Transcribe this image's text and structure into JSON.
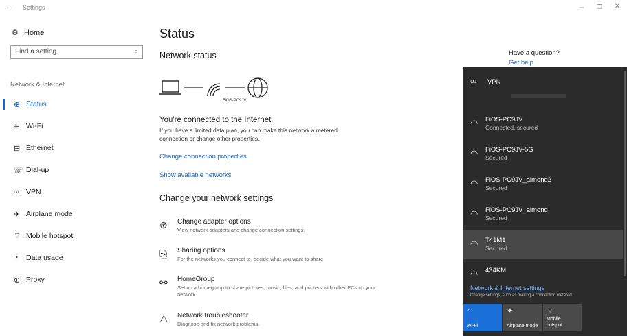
{
  "window": {
    "title": "Settings",
    "back_glyph": "←",
    "minimize": "–",
    "restore": "❐",
    "close": "✕"
  },
  "sidebar": {
    "home_label": "Home",
    "search_placeholder": "Find a setting",
    "section_label": "Network & Internet",
    "items": [
      {
        "label": "Status",
        "icon": "status-icon",
        "active": true
      },
      {
        "label": "Wi-Fi",
        "icon": "wifi-icon",
        "active": false
      },
      {
        "label": "Ethernet",
        "icon": "ethernet-icon",
        "active": false
      },
      {
        "label": "Dial-up",
        "icon": "dialup-icon",
        "active": false
      },
      {
        "label": "VPN",
        "icon": "vpn-icon",
        "active": false
      },
      {
        "label": "Airplane mode",
        "icon": "airplane-icon",
        "active": false
      },
      {
        "label": "Mobile hotspot",
        "icon": "hotspot-icon",
        "active": false
      },
      {
        "label": "Data usage",
        "icon": "data-usage-icon",
        "active": false
      },
      {
        "label": "Proxy",
        "icon": "proxy-icon",
        "active": false
      }
    ]
  },
  "main": {
    "title": "Status",
    "network_status": "Network status",
    "ssid": "FiOS-PC9JV",
    "connected_title": "You're connected to the Internet",
    "connected_desc": "If you have a limited data plan, you can make this network a metered connection or change other properties.",
    "change_props": "Change connection properties",
    "show_networks": "Show available networks",
    "change_settings_title": "Change your network settings",
    "options": [
      {
        "title": "Change adapter options",
        "desc": "View network adapters and change connection settings.",
        "icon": "adapter-icon"
      },
      {
        "title": "Sharing options",
        "desc": "For the networks you connect to, decide what you want to share.",
        "icon": "sharing-icon"
      },
      {
        "title": "HomeGroup",
        "desc": "Set up a homegroup to share pictures, music, files, and printers with other PCs on your network.",
        "icon": "homegroup-icon"
      },
      {
        "title": "Network troubleshooter",
        "desc": "Diagnose and fix network problems.",
        "icon": "warning-icon"
      }
    ]
  },
  "help": {
    "question": "Have a question?",
    "link": "Get help"
  },
  "flyout": {
    "vpn_label": "VPN",
    "networks": [
      {
        "name": "FiOS-PC9JV",
        "status": "Connected, secured"
      },
      {
        "name": "FiOS-PC9JV-5G",
        "status": "Secured"
      },
      {
        "name": "FiOS-PC9JV_almond2",
        "status": "Secured"
      },
      {
        "name": "FiOS-PC9JV_almond",
        "status": "Secured"
      },
      {
        "name": "T41M1",
        "status": "Secured"
      },
      {
        "name": "434KM",
        "status": ""
      }
    ],
    "settings_link": "Network & Internet settings",
    "settings_sub": "Change settings, such as making a connection metered.",
    "tiles": [
      {
        "label": "Wi-Fi",
        "on": true
      },
      {
        "label": "Airplane mode",
        "on": false
      },
      {
        "label": "Mobile hotspot",
        "on": false
      }
    ]
  },
  "colors": {
    "accent": "#1565c0",
    "flyout_bg": "#2b2b2b",
    "tile_on": "#1a6fd8"
  }
}
